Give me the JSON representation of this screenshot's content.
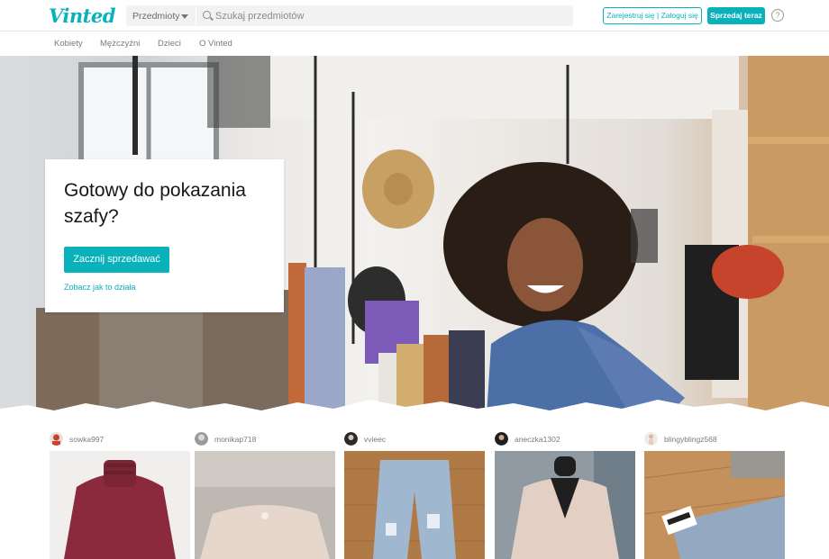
{
  "header": {
    "logo": "Vinted",
    "category_select": "Przedmioty",
    "search_placeholder": "Szukaj przedmiotów",
    "register_label": "Zarejestruj się | Zaloguj się",
    "sell_now_label": "Sprzedaj teraz",
    "help_icon": "?"
  },
  "nav": {
    "items": [
      "Kobiety",
      "Mężczyźni",
      "Dzieci",
      "O Vinted"
    ]
  },
  "hero": {
    "title": "Gotowy do pokazania szafy?",
    "cta_label": "Zacznij sprzedawać",
    "how_it_works_label": "Zobacz jak to działa"
  },
  "items": [
    {
      "username": "sowka997"
    },
    {
      "username": "monikap718"
    },
    {
      "username": "vvieec"
    },
    {
      "username": "aneczka1302"
    },
    {
      "username": "blingyblingz568"
    }
  ],
  "colors": {
    "brand": "#09b1ba"
  }
}
